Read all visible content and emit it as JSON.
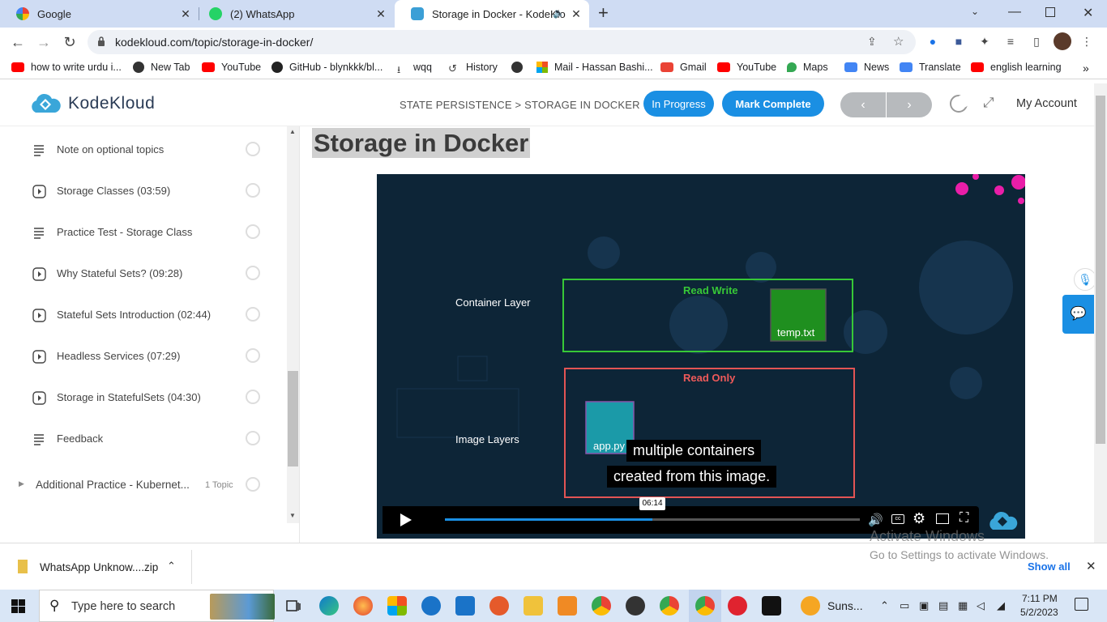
{
  "tabs": [
    {
      "title": "Google",
      "color": "#4285f4"
    },
    {
      "title": "(2) WhatsApp",
      "color": "#25d366"
    },
    {
      "title": "Storage in Docker - KodeKlo",
      "color": "#3b9fd6"
    }
  ],
  "toolbar": {
    "url": "kodekloud.com/topic/storage-in-docker/"
  },
  "bookmarks": [
    {
      "label": "how to write urdu i...",
      "color": "#ff0000"
    },
    {
      "label": "New Tab",
      "color": "#333333"
    },
    {
      "label": "YouTube",
      "color": "#ff0000"
    },
    {
      "label": "GitHub - blynkkk/bl...",
      "color": "#222222"
    },
    {
      "label": "wqq",
      "color": "#444444"
    },
    {
      "label": "History",
      "color": "#444444"
    },
    {
      "label": "",
      "color": "#333333"
    },
    {
      "label": "Mail - Hassan Bashi...",
      "color": "#f25022"
    },
    {
      "label": "Gmail",
      "color": "#ea4335"
    },
    {
      "label": "YouTube",
      "color": "#ff0000"
    },
    {
      "label": "Maps",
      "color": "#34a853"
    },
    {
      "label": "News",
      "color": "#4285f4"
    },
    {
      "label": "Translate",
      "color": "#4285f4"
    },
    {
      "label": "english learning",
      "color": "#ff0000"
    }
  ],
  "header": {
    "logo": "KodeKloud",
    "breadcrumb": "STATE PERSISTENCE > STORAGE IN DOCKER",
    "in_progress": "In Progress",
    "mark_complete": "Mark Complete",
    "prev": "‹",
    "next": "›",
    "my_account": "My Account"
  },
  "sidebar": {
    "lessons": [
      {
        "label": "Note on optional topics",
        "kind": "text"
      },
      {
        "label": "Storage Classes (03:59)",
        "kind": "video"
      },
      {
        "label": "Practice Test - Storage Class",
        "kind": "text"
      },
      {
        "label": "Why Stateful Sets? (09:28)",
        "kind": "video"
      },
      {
        "label": "Stateful Sets Introduction (02:44)",
        "kind": "video"
      },
      {
        "label": "Headless Services (07:29)",
        "kind": "video"
      },
      {
        "label": "Storage in StatefulSets (04:30)",
        "kind": "video"
      },
      {
        "label": "Feedback",
        "kind": "text"
      }
    ],
    "section": {
      "label": "Additional Practice - Kubernet...",
      "count": "1 Topic"
    }
  },
  "main": {
    "title": "Storage in Docker",
    "video": {
      "container_layer": "Container Layer",
      "image_layers": "Image Layers",
      "read_write": "Read Write",
      "read_only": "Read Only",
      "temp_file": "temp.txt",
      "app_file": "app.py",
      "caption_line1": "multiple containers",
      "caption_line2": "created from this image.",
      "time": "06:14",
      "progress": 0.5
    }
  },
  "download": {
    "file": "WhatsApp Unknow....zip",
    "show_all": "Show all"
  },
  "watermark": {
    "line1": "Activate Windows",
    "line2": "Go to Settings to activate Windows."
  },
  "taskbar": {
    "search_placeholder": "Type here to search",
    "weather": "Suns...",
    "time": "7:11 PM",
    "date": "5/2/2023"
  }
}
